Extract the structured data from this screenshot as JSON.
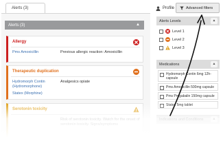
{
  "tabs": {
    "alerts_tab": "Alerts (3)"
  },
  "alerts_panel": {
    "header": "Alerts (3)"
  },
  "alerts": [
    {
      "title": "Allergy",
      "title_color": "#cc1f1f",
      "drug": "Pms Amoxicillin",
      "detail": "Previous allergic reaction: Amoxicillin",
      "icon": "error-x-icon"
    },
    {
      "title": "Therapeutic duplication",
      "title_color": "#e0701d",
      "drug_line1": "Hydromorph Contin",
      "drug_line2": "(Hydromorphone)",
      "drug_line3": "Statex (Morphine)",
      "detail": "Analgesics opiate",
      "icon": "minus-circle-icon"
    },
    {
      "title": "Serotonin toxicity",
      "title_color": "#e0a21d",
      "detail_fragment": "Risk of serotonin toxicity. Watch for the onset of",
      "detail_fragment2": "serotonin toxicity. Signs/symptoms",
      "icon": "warning-triangle-icon"
    }
  ],
  "toolbar": {
    "profile_label": "Profile",
    "advanced_filters_label": "Advanced filters"
  },
  "filters": {
    "alert_levels": {
      "header": "Alerts Levels",
      "levels": [
        "Level 1",
        "Level 2",
        "Level 3"
      ]
    },
    "medications": {
      "header": "Medications",
      "items": [
        "Hydromorph Contin 6mg 12h-capsule",
        "Pms Amoxicillin 500mg capsule",
        "Pms Pregabalin 150mg capsule",
        "Statex 5mg tablet"
      ]
    },
    "indications": {
      "header": "Indications and Conditions"
    }
  },
  "colors": {
    "allergy": "#cc1f1f",
    "duplication": "#e0701d",
    "serotonin": "#e0a21d",
    "link": "#3a6fb0",
    "panel_header": "#dcdcdc",
    "alerts_header": "#999a9c"
  }
}
